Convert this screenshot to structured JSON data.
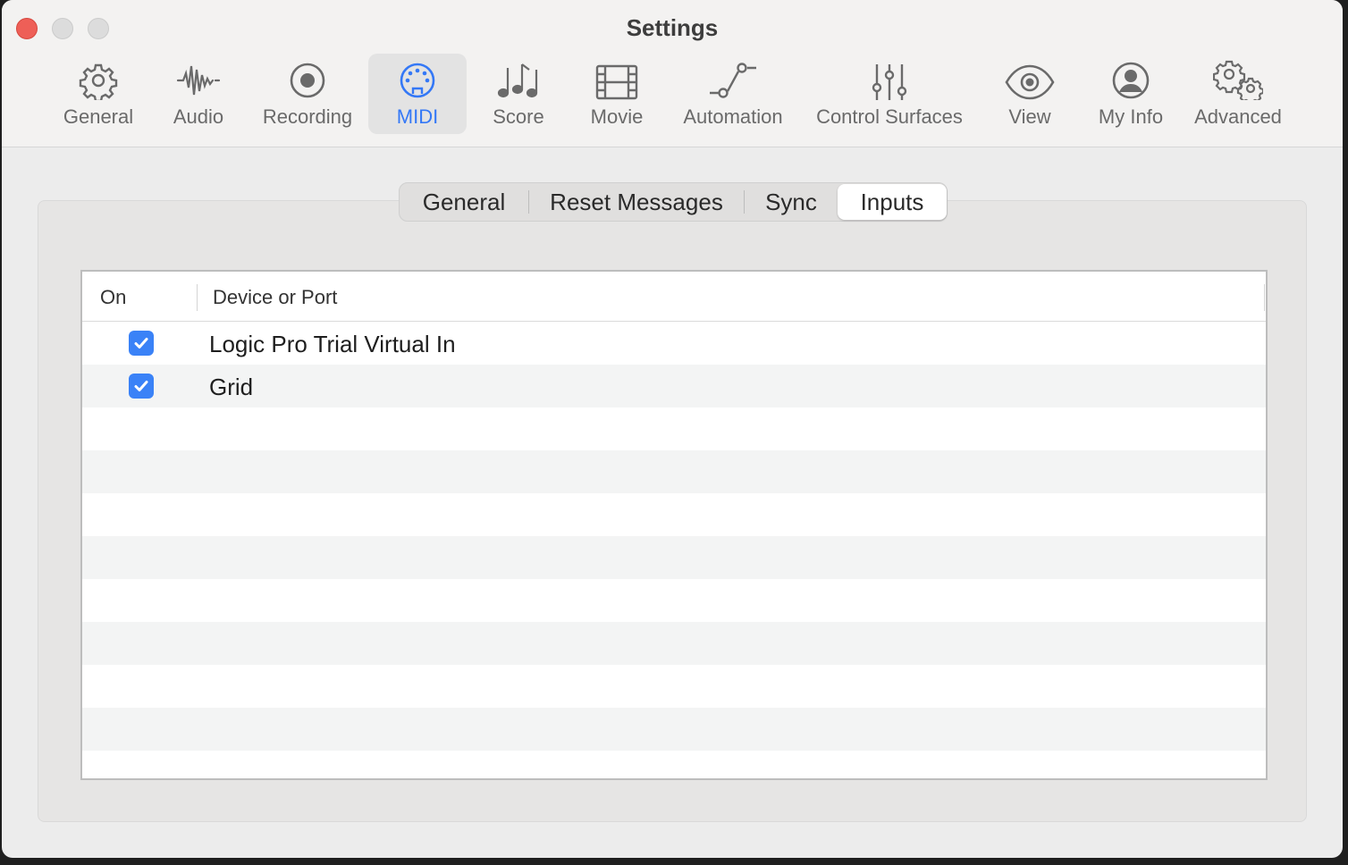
{
  "window": {
    "title": "Settings"
  },
  "toolbar": {
    "items": [
      {
        "label": "General",
        "icon": "gear-icon",
        "selected": false
      },
      {
        "label": "Audio",
        "icon": "waveform-icon",
        "selected": false
      },
      {
        "label": "Recording",
        "icon": "record-icon",
        "selected": false
      },
      {
        "label": "MIDI",
        "icon": "midi-connector-icon",
        "selected": true
      },
      {
        "label": "Score",
        "icon": "music-notes-icon",
        "selected": false
      },
      {
        "label": "Movie",
        "icon": "film-icon",
        "selected": false
      },
      {
        "label": "Automation",
        "icon": "automation-curve-icon",
        "selected": false
      },
      {
        "label": "Control Surfaces",
        "icon": "sliders-icon",
        "selected": false
      },
      {
        "label": "View",
        "icon": "eye-icon",
        "selected": false
      },
      {
        "label": "My Info",
        "icon": "person-icon",
        "selected": false
      },
      {
        "label": "Advanced",
        "icon": "gears-icon",
        "selected": false
      }
    ],
    "accent": "#3478f6"
  },
  "subtabs": {
    "items": [
      "General",
      "Reset Messages",
      "Sync",
      "Inputs"
    ],
    "active": "Inputs"
  },
  "table": {
    "columns": [
      "On",
      "Device or Port"
    ],
    "rows": [
      {
        "on": true,
        "name": "Logic Pro Trial Virtual In"
      },
      {
        "on": true,
        "name": "Grid"
      }
    ],
    "checkbox_color": "#3a82f7"
  }
}
